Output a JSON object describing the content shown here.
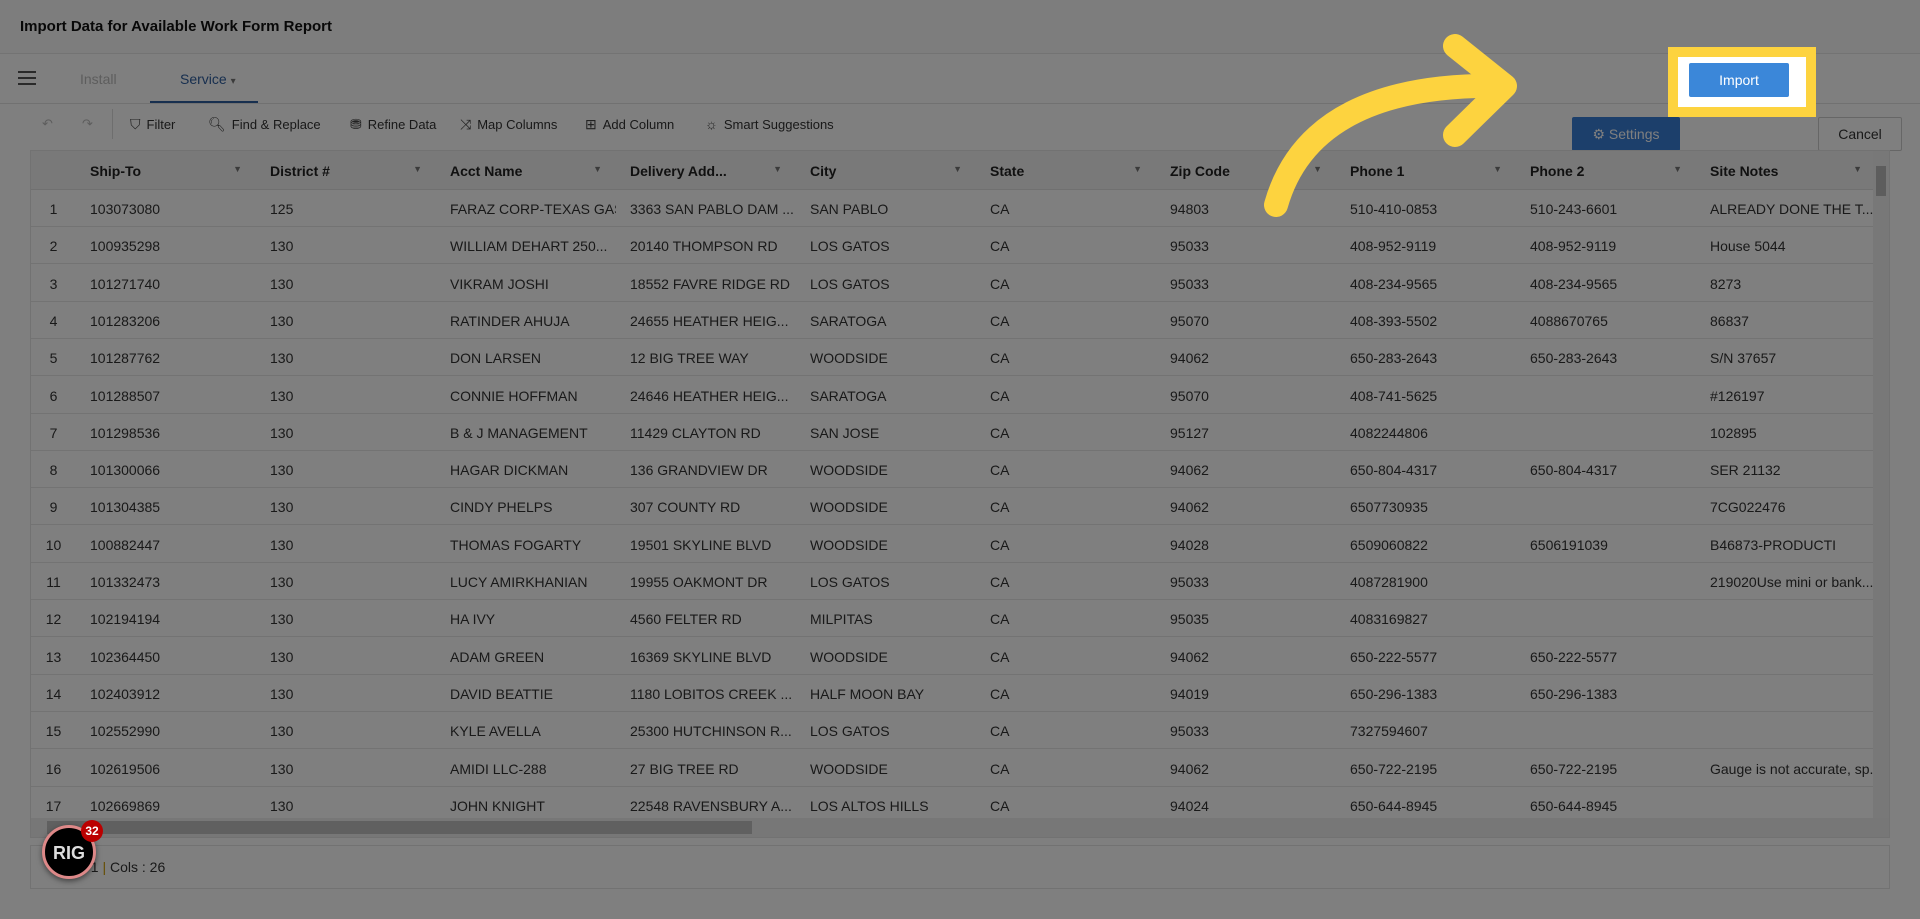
{
  "window": {
    "title": "Import Data for Available Work Form Report"
  },
  "tabs": [
    {
      "label": "Install",
      "active": false
    },
    {
      "label": "Service",
      "active": true,
      "caret": "▾"
    }
  ],
  "actions": {
    "settings": "Settings",
    "import": "Import",
    "cancel": "Cancel"
  },
  "toolbar": {
    "undo_icon": "↶",
    "redo_icon": "↷",
    "items": [
      {
        "icon": "filter-icon",
        "glyph": "⛉",
        "label": "Filter"
      },
      {
        "icon": "search-icon",
        "glyph": "🔍︎",
        "label": "Find & Replace"
      },
      {
        "icon": "refine-icon",
        "glyph": "⛃",
        "label": "Refine Data"
      },
      {
        "icon": "map-columns-icon",
        "glyph": "⤨",
        "label": "Map Columns"
      },
      {
        "icon": "add-column-icon",
        "glyph": "⊞",
        "label": "Add Column"
      },
      {
        "icon": "lightbulb-icon",
        "glyph": "☼",
        "label": "Smart Suggestions"
      }
    ]
  },
  "grid": {
    "columns": [
      "Ship-To",
      "District #",
      "Acct Name",
      "Delivery Add...",
      "City",
      "State",
      "Zip Code",
      "Phone 1",
      "Phone 2",
      "Site Notes"
    ],
    "rows": [
      [
        "1",
        "103073080",
        "125",
        "FARAZ CORP-TEXAS GAS",
        "3363 SAN PABLO DAM ...",
        "SAN PABLO",
        "CA",
        "94803",
        "510-410-0853",
        "510-243-6601",
        "ALREADY DONE THE T..."
      ],
      [
        "2",
        "100935298",
        "130",
        "WILLIAM DEHART 250...",
        "20140 THOMPSON RD",
        "LOS GATOS",
        "CA",
        "95033",
        "408-952-9119",
        "408-952-9119",
        "House 5044"
      ],
      [
        "3",
        "101271740",
        "130",
        "VIKRAM JOSHI",
        "18552 FAVRE RIDGE RD",
        "LOS GATOS",
        "CA",
        "95033",
        "408-234-9565",
        "408-234-9565",
        "8273"
      ],
      [
        "4",
        "101283206",
        "130",
        "RATINDER AHUJA",
        "24655 HEATHER HEIG...",
        "SARATOGA",
        "CA",
        "95070",
        "408-393-5502",
        "4088670765",
        "86837"
      ],
      [
        "5",
        "101287762",
        "130",
        "DON LARSEN",
        "12 BIG TREE WAY",
        "WOODSIDE",
        "CA",
        "94062",
        "650-283-2643",
        "650-283-2643",
        "S/N 37657"
      ],
      [
        "6",
        "101288507",
        "130",
        "CONNIE HOFFMAN",
        "24646 HEATHER HEIG...",
        "SARATOGA",
        "CA",
        "95070",
        "408-741-5625",
        "",
        "#126197"
      ],
      [
        "7",
        "101298536",
        "130",
        "B & J MANAGEMENT",
        "11429 CLAYTON RD",
        "SAN JOSE",
        "CA",
        "95127",
        "4082244806",
        "",
        "102895"
      ],
      [
        "8",
        "101300066",
        "130",
        "HAGAR DICKMAN",
        "136 GRANDVIEW DR",
        "WOODSIDE",
        "CA",
        "94062",
        "650-804-4317",
        "650-804-4317",
        "SER 21132"
      ],
      [
        "9",
        "101304385",
        "130",
        "CINDY PHELPS",
        "307 COUNTY RD",
        "WOODSIDE",
        "CA",
        "94062",
        "6507730935",
        "",
        "7CG022476"
      ],
      [
        "10",
        "100882447",
        "130",
        "THOMAS FOGARTY",
        "19501 SKYLINE BLVD",
        "WOODSIDE",
        "CA",
        "94028",
        "6509060822",
        "6506191039",
        "B46873-PRODUCTI"
      ],
      [
        "11",
        "101332473",
        "130",
        "LUCY AMIRKHANIAN",
        "19955 OAKMONT DR",
        "LOS GATOS",
        "CA",
        "95033",
        "4087281900",
        "",
        "219020Use mini or bank..."
      ],
      [
        "12",
        "102194194",
        "130",
        "HA IVY",
        "4560 FELTER RD",
        "MILPITAS",
        "CA",
        "95035",
        "4083169827",
        "",
        ""
      ],
      [
        "13",
        "102364450",
        "130",
        "ADAM GREEN",
        "16369 SKYLINE BLVD",
        "WOODSIDE",
        "CA",
        "94062",
        "650-222-5577",
        "650-222-5577",
        ""
      ],
      [
        "14",
        "102403912",
        "130",
        "DAVID BEATTIE",
        "1180 LOBITOS CREEK ...",
        "HALF MOON BAY",
        "CA",
        "94019",
        "650-296-1383",
        "650-296-1383",
        ""
      ],
      [
        "15",
        "102552990",
        "130",
        "KYLE AVELLA",
        "25300 HUTCHINSON R...",
        "LOS GATOS",
        "CA",
        "95033",
        "7327594607",
        "",
        ""
      ],
      [
        "16",
        "102619506",
        "130",
        "AMIDI LLC-288",
        "27 BIG TREE RD",
        "WOODSIDE",
        "CA",
        "94062",
        "650-722-2195",
        "650-722-2195",
        "Gauge is not accurate, sp..."
      ],
      [
        "17",
        "102669869",
        "130",
        "JOHN KNIGHT",
        "22548 RAVENSBURY A...",
        "LOS ALTOS HILLS",
        "CA",
        "94024",
        "650-644-8945",
        "650-644-8945",
        ""
      ]
    ]
  },
  "footer": {
    "rows_partial": "71",
    "sep": " | ",
    "cols": "Cols : 26"
  },
  "badge": {
    "logo": "RIG",
    "count": "32"
  },
  "colors": {
    "highlight": "#fdd33f",
    "import": "#3b87d9",
    "settings": "#387ed6",
    "tab_active": "#2f5e9e"
  }
}
